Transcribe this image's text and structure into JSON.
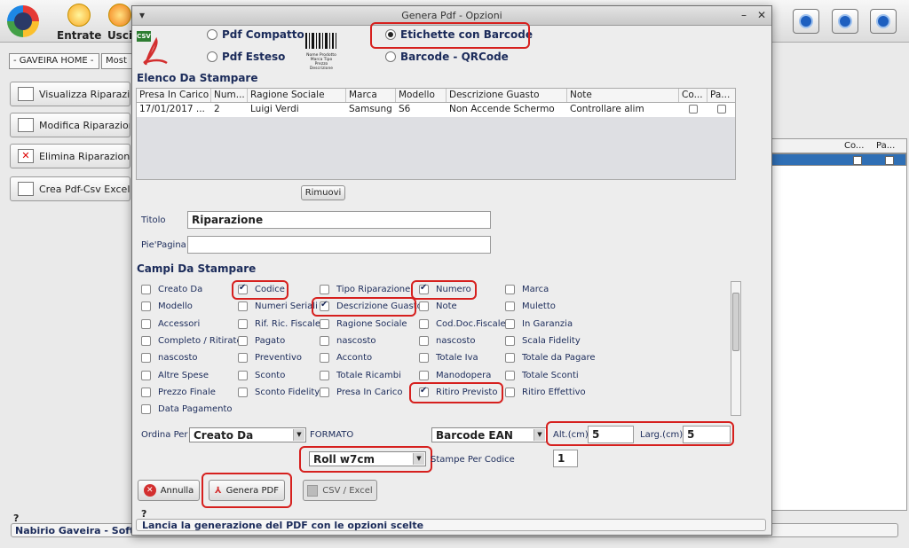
{
  "app": {
    "toolbar": [
      {
        "label": "Entrate"
      },
      {
        "label": "Usci"
      }
    ],
    "tabs": [
      {
        "label": "- GAVEIRA HOME -"
      },
      {
        "label": "Most"
      }
    ],
    "left_buttons": [
      {
        "label": "Visualizza Riparazion"
      },
      {
        "label": "Modifica Riparazione"
      },
      {
        "label": "Elimina Riparazione"
      },
      {
        "label": "Crea Pdf-Csv Excel"
      }
    ],
    "right_panel_headers": [
      "Co...",
      "Pa..."
    ],
    "status_label": "?",
    "status_text": "Nabirio Gaveira - Softw"
  },
  "dialog": {
    "title": "Genera Pdf - Opzioni",
    "window_controls": {
      "minimize": "–",
      "close": "✕",
      "menu": "▾"
    },
    "pdf_icon_text": "CSV",
    "barcode_caption": "Nome Prodotto Marca Tipo Prezzo Descrizione",
    "format_options": [
      {
        "label": "Pdf Compatto",
        "selected": false
      },
      {
        "label": "Pdf Esteso",
        "selected": false
      },
      {
        "label": "Etichette con Barcode",
        "selected": true
      },
      {
        "label": "Barcode - QRCode",
        "selected": false
      }
    ],
    "list_title": "Elenco Da Stampare",
    "table": {
      "columns": [
        "Presa In Carico",
        "Num...",
        "Ragione Sociale",
        "Marca",
        "Modello",
        "Descrizione Guasto",
        "Note",
        "Co...",
        "Pa..."
      ],
      "rows": [
        [
          "17/01/2017 ...",
          "2",
          "Luigi  Verdi",
          "Samsung",
          "S6",
          "Non Accende Schermo",
          "Controllare alim",
          "",
          ""
        ]
      ]
    },
    "remove_button": "Rimuovi",
    "title_label": "Titolo",
    "title_value": "Riparazione",
    "footer_label": "Pie'Pagina",
    "footer_value": "",
    "fields_title": "Campi Da Stampare",
    "fields": [
      [
        {
          "label": "Creato Da",
          "checked": false
        },
        {
          "label": "Codice",
          "checked": true
        },
        {
          "label": "Tipo Riparazione",
          "checked": false
        },
        {
          "label": "Numero",
          "checked": true
        },
        {
          "label": "Marca",
          "checked": false
        }
      ],
      [
        {
          "label": "Modello",
          "checked": false
        },
        {
          "label": "Numeri Seriali",
          "checked": false
        },
        {
          "label": "Descrizione Guasto",
          "checked": true
        },
        {
          "label": "Note",
          "checked": false
        },
        {
          "label": "Muletto",
          "checked": false
        }
      ],
      [
        {
          "label": "Accessori",
          "checked": false
        },
        {
          "label": "Rif. Ric. Fiscale",
          "checked": false
        },
        {
          "label": "Ragione Sociale",
          "checked": false
        },
        {
          "label": "Cod.Doc.Fiscale",
          "checked": false
        },
        {
          "label": "In Garanzia",
          "checked": false
        }
      ],
      [
        {
          "label": "Completo / Ritirato",
          "checked": false
        },
        {
          "label": "Pagato",
          "checked": false
        },
        {
          "label": "nascosto",
          "checked": false
        },
        {
          "label": "nascosto",
          "checked": false
        },
        {
          "label": "Scala Fidelity",
          "checked": false
        }
      ],
      [
        {
          "label": "nascosto",
          "checked": false
        },
        {
          "label": "Preventivo",
          "checked": false
        },
        {
          "label": "Acconto",
          "checked": false
        },
        {
          "label": "Totale Iva",
          "checked": false
        },
        {
          "label": "Totale da Pagare",
          "checked": false
        }
      ],
      [
        {
          "label": "Altre Spese",
          "checked": false
        },
        {
          "label": "Sconto",
          "checked": false
        },
        {
          "label": "Totale Ricambi",
          "checked": false
        },
        {
          "label": "Manodopera",
          "checked": false
        },
        {
          "label": "Totale Sconti",
          "checked": false
        }
      ],
      [
        {
          "label": "Prezzo Finale",
          "checked": false
        },
        {
          "label": "Sconto Fidelity",
          "checked": false
        },
        {
          "label": "Presa In Carico",
          "checked": false
        },
        {
          "label": "Ritiro Previsto",
          "checked": true
        },
        {
          "label": "Ritiro Effettivo",
          "checked": false
        }
      ],
      [
        {
          "label": "Data Pagamento",
          "checked": false
        }
      ]
    ],
    "order_label": "Ordina Per",
    "order_value": "Creato Da",
    "format_label": "FORMATO",
    "barcode_type": "Barcode EAN",
    "alt_label": "Alt.(cm)",
    "alt_value": "5",
    "larg_label": "Larg.(cm)",
    "larg_value": "5",
    "roll_value": "Roll w7cm",
    "copies_label": "Stampe Per Codice",
    "copies_value": "1",
    "cancel_button": "Annulla",
    "generate_button": "Genera PDF",
    "csv_button": "CSV / Excel",
    "status_label": "?",
    "status_text": "Lancia la generazione del PDF con le opzioni scelte"
  }
}
